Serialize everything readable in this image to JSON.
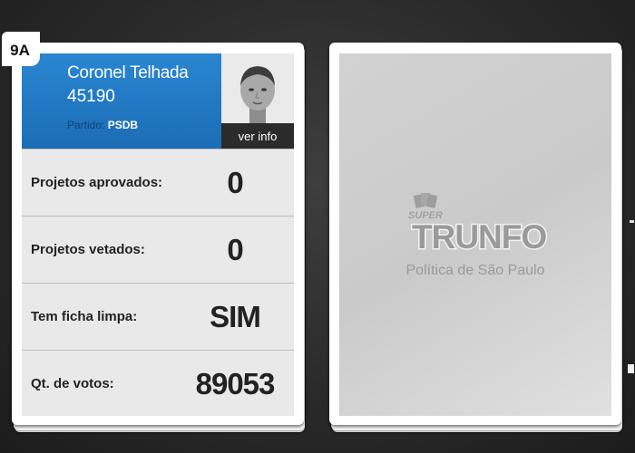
{
  "card": {
    "code": "9A",
    "candidate_name": "Coronel Telhada",
    "candidate_number": "45190",
    "party_label": "Partido:",
    "party_value": "PSDB",
    "info_button_label": "ver info",
    "stats": [
      {
        "label": "Projetos aprovados:",
        "value": "0"
      },
      {
        "label": "Projetos vetados:",
        "value": "0"
      },
      {
        "label": "Tem ficha limpa:",
        "value": "SIM"
      },
      {
        "label": "Qt. de votos:",
        "value": "89053"
      }
    ]
  },
  "deck": {
    "logo_small": "SUPER",
    "logo_main": "TRUNFO",
    "subtitle": "Política de São Paulo"
  },
  "colors": {
    "header_blue": "#1f74bd",
    "stat_background": "#e9e9e9",
    "background": "#2a2a2a"
  },
  "icons": [
    "candidate-photo",
    "trunfo-logo-icon"
  ]
}
